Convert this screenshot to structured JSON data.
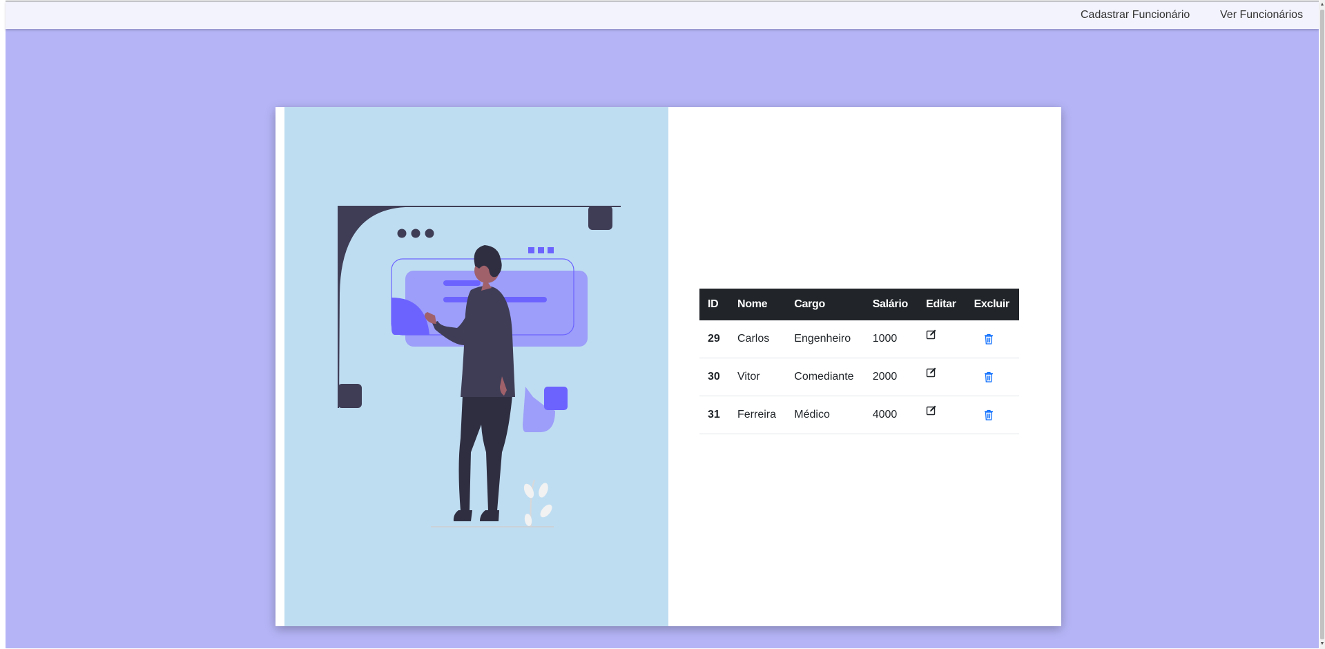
{
  "nav": {
    "links": [
      "Cadastrar Funcionário",
      "Ver Funcionários"
    ]
  },
  "table": {
    "headers": [
      "ID",
      "Nome",
      "Cargo",
      "Salário",
      "Editar",
      "Excluir"
    ],
    "rows": [
      {
        "id": "29",
        "nome": "Carlos",
        "cargo": "Engenheiro",
        "salario": "1000"
      },
      {
        "id": "30",
        "nome": "Vitor",
        "cargo": "Comediante",
        "salario": "2000"
      },
      {
        "id": "31",
        "nome": "Ferreira",
        "cargo": "Médico",
        "salario": "4000"
      }
    ],
    "edit_icon": "edit-icon",
    "delete_icon": "trash-icon"
  },
  "colors": {
    "page_background": "#b5b4f6",
    "navbar": "#f3f3fd",
    "illustration_background": "#bfddf1",
    "table_header": "#212529",
    "accent_purple": "#6c63ff",
    "delete_blue": "#0d6efd"
  }
}
